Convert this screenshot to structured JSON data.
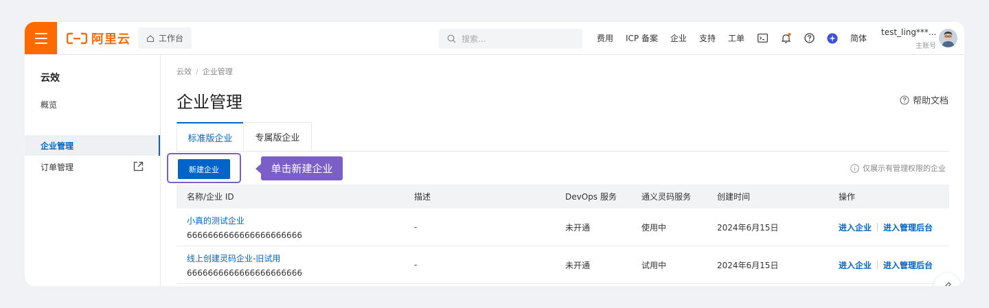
{
  "brand": {
    "logo_text": "阿里云",
    "accent": "#ff6a00",
    "primary": "#0064c8",
    "callout_color": "#7b5ec6"
  },
  "topbar": {
    "workbench_label": "工作台",
    "search_placeholder": "搜索...",
    "links": [
      "费用",
      "ICP 备案",
      "企业",
      "支持",
      "工单"
    ],
    "icons": [
      "terminal-icon",
      "bell-icon",
      "help-circle-icon",
      "app-icon"
    ],
    "language": "简体",
    "user_name": "test_ling***...",
    "user_role": "主账号"
  },
  "sidebar": {
    "title": "云效",
    "items": [
      {
        "label": "概览",
        "active": false
      },
      {
        "label": "企业管理",
        "active": true
      },
      {
        "label": "订单管理",
        "active": false,
        "external": true
      }
    ]
  },
  "main": {
    "breadcrumb": [
      "云效",
      "企业管理"
    ],
    "title": "企业管理",
    "help_label": "帮助文档",
    "tabs": [
      {
        "label": "标准版企业",
        "active": true
      },
      {
        "label": "专属版企业",
        "active": false
      }
    ],
    "new_button_label": "新建企业",
    "callout_text": "单击新建企业",
    "hint_text": "仅展示有管理权限的企业"
  },
  "table": {
    "headers": [
      "名称/企业 ID",
      "描述",
      "DevOps 服务",
      "通义灵码服务",
      "创建时间",
      "操作"
    ],
    "rows": [
      {
        "name": "小真的测试企业",
        "id": "6666666666666666666666",
        "desc": "-",
        "devops": "未开通",
        "lingma": "使用中",
        "created": "2024年6月15日",
        "op1": "进入企业",
        "op2": "进入管理后台"
      },
      {
        "name": "线上创建灵码企业-旧试用",
        "id": "6666666666666666666666",
        "desc": "-",
        "devops": "未开通",
        "lingma": "试用中",
        "created": "2024年6月15日",
        "op1": "进入企业",
        "op2": "进入管理后台"
      }
    ]
  }
}
